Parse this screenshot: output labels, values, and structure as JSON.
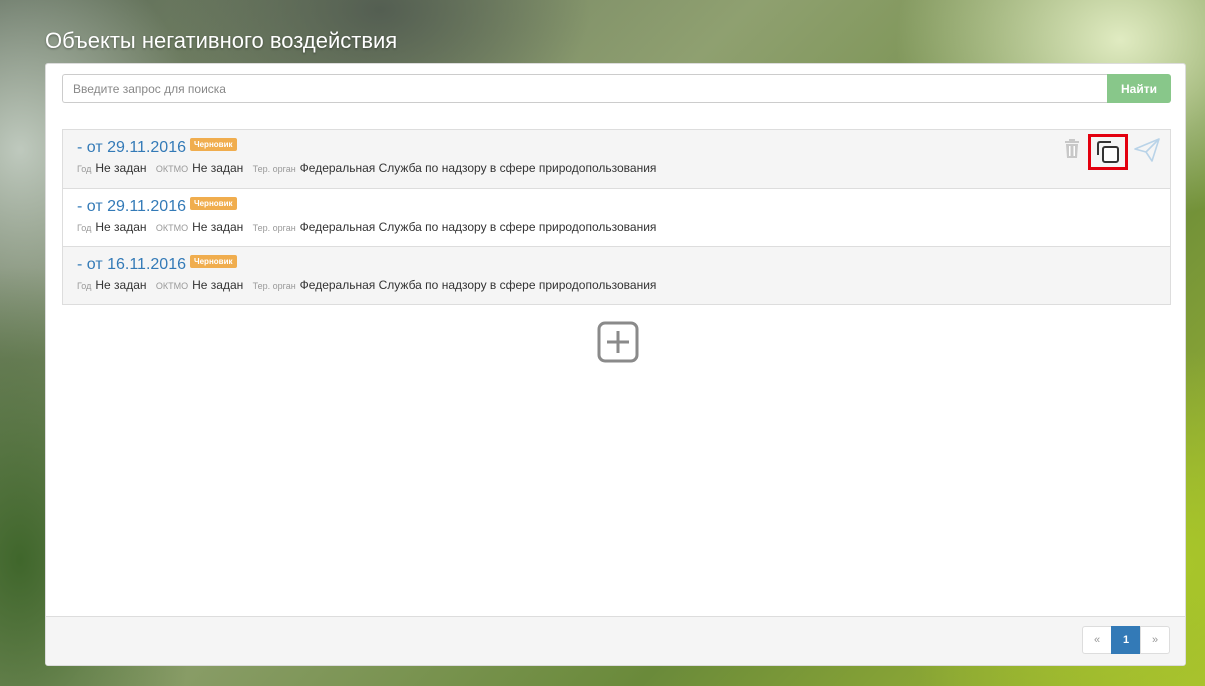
{
  "page": {
    "title": "Объекты негативного воздействия"
  },
  "search": {
    "placeholder": "Введите запрос для поиска",
    "button_label": "Найти",
    "button_color": "#88c78a"
  },
  "records": [
    {
      "date": "- от 29.11.2016",
      "status": "Черновик",
      "year_label": "Год",
      "year_value": "Не задан",
      "oktmo_label": "ОКТМО",
      "oktmo_value": "Не задан",
      "organ_label": "Тер. орган",
      "organ_value": "Федеральная Служба по надзору в сфере природопользования"
    },
    {
      "date": "- от 29.11.2016",
      "status": "Черновик",
      "year_label": "Год",
      "year_value": "Не задан",
      "oktmo_label": "ОКТМО",
      "oktmo_value": "Не задан",
      "organ_label": "Тер. орган",
      "organ_value": "Федеральная Служба по надзору в сфере природопользования"
    },
    {
      "date": "- от 16.11.2016",
      "status": "Черновик",
      "year_label": "Год",
      "year_value": "Не задан",
      "oktmo_label": "ОКТМО",
      "oktmo_value": "Не задан",
      "organ_label": "Тер. орган",
      "organ_value": "Федеральная Служба по надзору в сфере природопользования"
    }
  ],
  "row_actions": {
    "icons": [
      "trash-icon",
      "copy-icon",
      "send-icon"
    ],
    "highlight_color": "#e3000f"
  },
  "add": {
    "icon": "plus-square-icon"
  },
  "pagination": {
    "prev": "«",
    "current": "1",
    "next": "»",
    "active_color": "#337ab7"
  },
  "colors": {
    "link": "#337ab7",
    "badge": "#f0ad4e"
  }
}
